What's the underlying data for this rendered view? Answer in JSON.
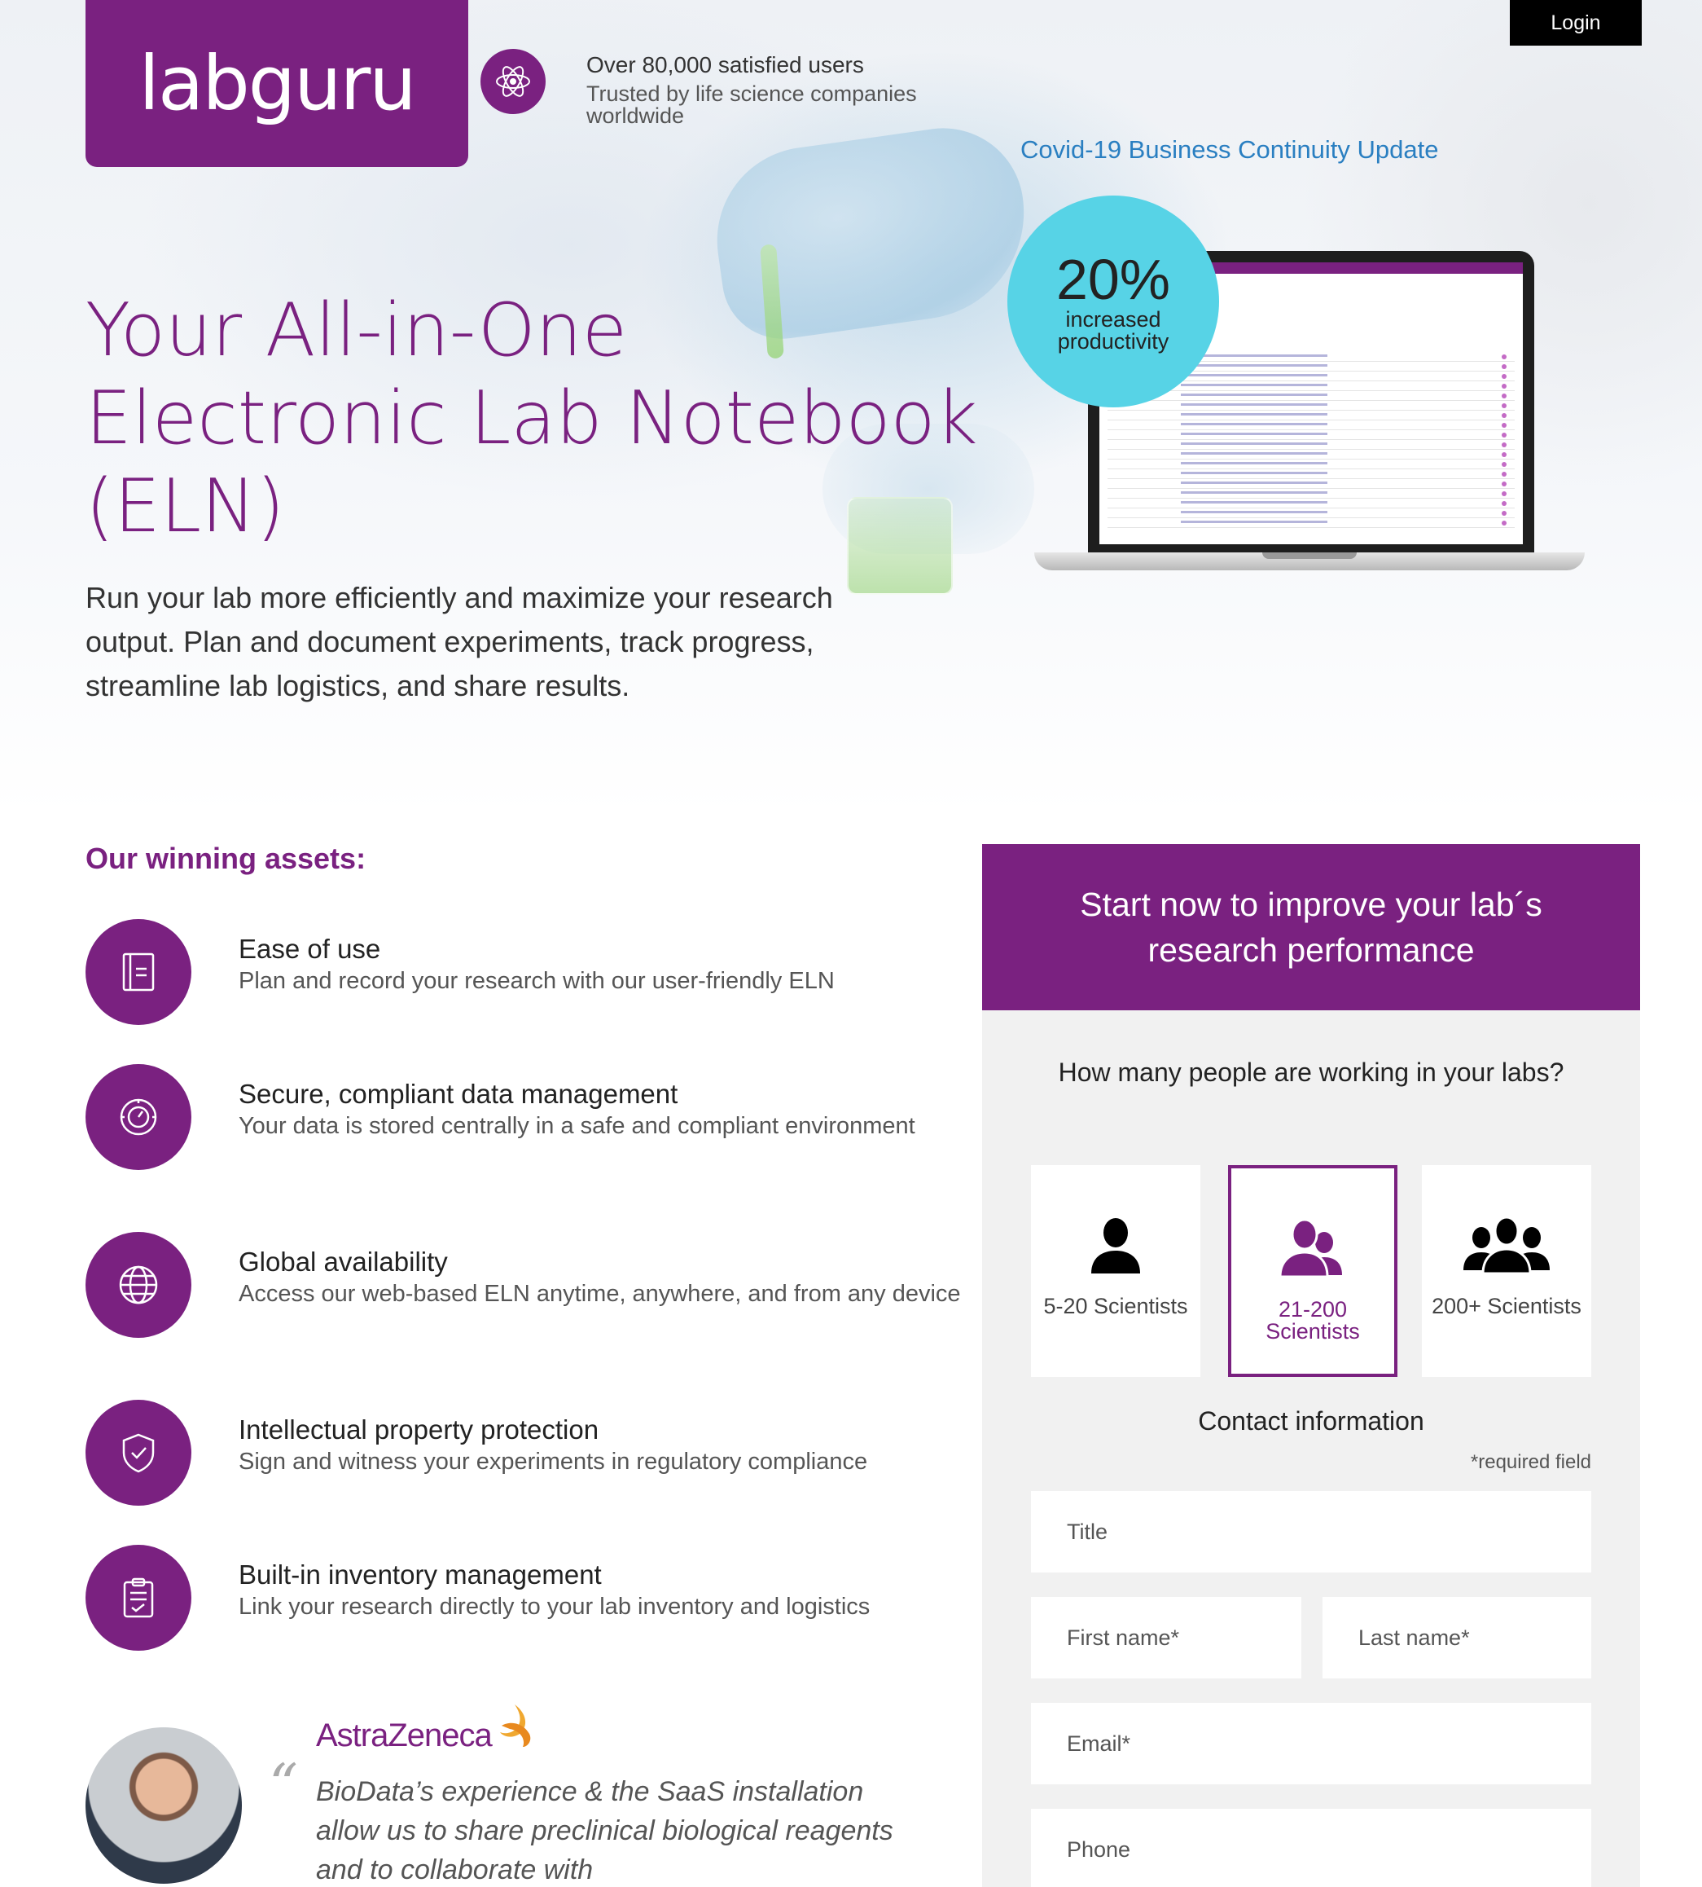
{
  "brand": {
    "logo_text": "labguru",
    "tagline_primary": "Over 80,000 satisfied users",
    "tagline_secondary": "Trusted by life science companies worldwide",
    "color": "#7a2180"
  },
  "header": {
    "login_label": "Login",
    "covid_link": "Covid-19 Business Continuity Update"
  },
  "hero": {
    "title_lines": [
      "Your All-in-One",
      "Electronic Lab Notebook",
      "(ELN)"
    ],
    "description": "Run your lab more efficiently and maximize your research output. Plan and document experiments, track progress, streamline lab logistics, and share results."
  },
  "stat": {
    "value": "20%",
    "label": "increased productivity",
    "color": "#57d3e6"
  },
  "assets": {
    "heading": "Our winning assets:",
    "items": [
      {
        "title": "Ease of use",
        "description": "Plan and record your research with our user-friendly ELN",
        "icon": "notebook-icon"
      },
      {
        "title": "Secure, compliant data management",
        "description": "Your data is stored centrally in a safe and compliant environment",
        "icon": "safe-dial-icon"
      },
      {
        "title": "Global availability",
        "description": "Access our web-based ELN anytime, anywhere, and from any device",
        "icon": "globe-icon"
      },
      {
        "title": "Intellectual property protection",
        "description": "Sign and witness your experiments in regulatory compliance",
        "icon": "shield-check-icon"
      },
      {
        "title": "Built-in inventory management",
        "description": "Link your research directly to your lab inventory and logistics",
        "icon": "clipboard-check-icon"
      }
    ]
  },
  "testimonial": {
    "company": "AstraZeneca",
    "quote_mark": "“",
    "quote": "BioData’s experience & the SaaS installation allow us to share preclinical biological reagents and to collaborate with"
  },
  "form": {
    "heading": "Start now to improve your lab´s research performance",
    "question": "How many people are working in your labs?",
    "options": [
      {
        "label": "5-20 Scientists",
        "icon": "single-person-icon",
        "selected": false
      },
      {
        "label": "21-200 Scientists",
        "icon": "two-people-icon",
        "selected": true
      },
      {
        "label": "200+ Scientists",
        "icon": "group-people-icon",
        "selected": false
      }
    ],
    "contact_title": "Contact information",
    "required_note": "*required field",
    "fields": {
      "title": "Title",
      "first_name": "First name*",
      "last_name": "Last name*",
      "email": "Email*",
      "phone": "Phone"
    }
  }
}
